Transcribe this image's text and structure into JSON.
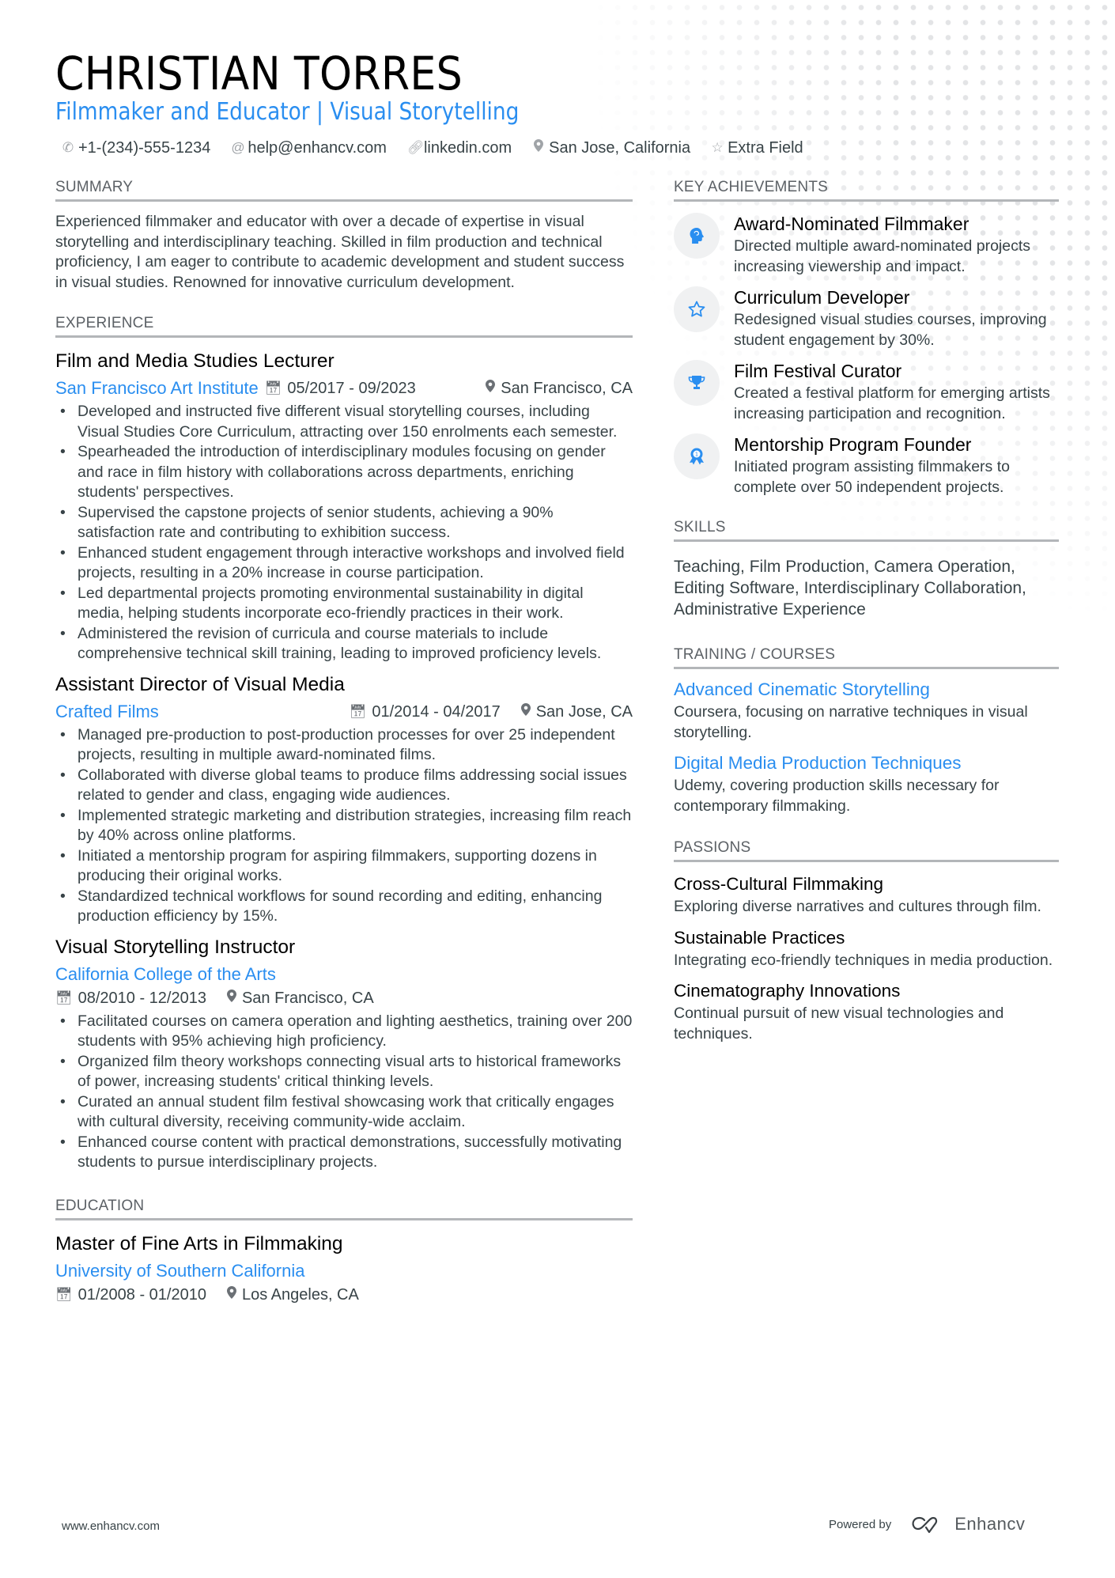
{
  "header": {
    "name": "CHRISTIAN TORRES",
    "headline": "Filmmaker and Educator | Visual Storytelling",
    "contacts": [
      {
        "icon": "phone-icon",
        "value": "+1-(234)-555-1234"
      },
      {
        "icon": "at-icon",
        "value": "help@enhancv.com"
      },
      {
        "icon": "link-icon",
        "value": "linkedin.com"
      },
      {
        "icon": "location-icon",
        "value": "San Jose, California"
      },
      {
        "icon": "star-icon",
        "value": "Extra Field"
      }
    ]
  },
  "summary": {
    "title": "SUMMARY",
    "text": "Experienced filmmaker and educator with over a decade of expertise in visual storytelling and interdisciplinary teaching. Skilled in film production and technical proficiency, I am eager to contribute to academic development and student success in visual studies. Renowned for innovative curriculum development."
  },
  "experience": {
    "title": "EXPERIENCE",
    "jobs": [
      {
        "title": "Film and Media Studies Lecturer",
        "company": "San Francisco Art Institute",
        "dates": "05/2017 - 09/2023",
        "location": "San Francisco, CA",
        "bullets": [
          "Developed and instructed five different visual storytelling courses, including Visual Studies Core Curriculum, attracting over 150 enrolments each semester.",
          "Spearheaded the introduction of interdisciplinary modules focusing on gender and race in film history with collaborations across departments, enriching students' perspectives.",
          "Supervised the capstone projects of senior students, achieving a 90% satisfaction rate and contributing to exhibition success.",
          "Enhanced student engagement through interactive workshops and involved field projects, resulting in a 20% increase in course participation.",
          "Led departmental projects promoting environmental sustainability in digital media, helping students incorporate eco-friendly practices in their work.",
          "Administered the revision of curricula and course materials to include comprehensive technical skill training, leading to improved proficiency levels."
        ]
      },
      {
        "title": "Assistant Director of Visual Media",
        "company": "Crafted Films",
        "dates": "01/2014 - 04/2017",
        "location": "San Jose, CA",
        "bullets": [
          "Managed pre-production to post-production processes for over 25 independent projects, resulting in multiple award-nominated films.",
          "Collaborated with diverse global teams to produce films addressing social issues related to gender and class, engaging wide audiences.",
          "Implemented strategic marketing and distribution strategies, increasing film reach by 40% across online platforms.",
          "Initiated a mentorship program for aspiring filmmakers, supporting dozens in producing their original works.",
          "Standardized technical workflows for sound recording and editing, enhancing production efficiency by 15%."
        ]
      },
      {
        "title": "Visual Storytelling Instructor",
        "company": "California College of the Arts",
        "dates": "08/2010 - 12/2013",
        "location": "San Francisco, CA",
        "bullets": [
          "Facilitated courses on camera operation and lighting aesthetics, training over 200 students with 95% achieving high proficiency.",
          "Organized film theory workshops connecting visual arts to historical frameworks of power, increasing students' critical thinking levels.",
          "Curated an annual student film festival showcasing work that critically engages with cultural diversity, receiving community-wide acclaim.",
          "Enhanced course content with practical demonstrations, successfully motivating students to pursue interdisciplinary projects."
        ]
      }
    ]
  },
  "education": {
    "title": "EDUCATION",
    "degree": "Master of Fine Arts in Filmmaking",
    "school": "University of Southern California",
    "dates": "01/2008 - 01/2010",
    "location": "Los Angeles, CA"
  },
  "achievements": {
    "title": "KEY ACHIEVEMENTS",
    "items": [
      {
        "icon": "brain-head-icon",
        "title": "Award-Nominated Filmmaker",
        "desc": "Directed multiple award-nominated projects increasing viewership and impact."
      },
      {
        "icon": "star-icon",
        "title": "Curriculum Developer",
        "desc": "Redesigned visual studies courses, improving student engagement by 30%."
      },
      {
        "icon": "trophy-icon",
        "title": "Film Festival Curator",
        "desc": "Created a festival platform for emerging artists increasing participation and recognition."
      },
      {
        "icon": "award-ribbon-icon",
        "title": "Mentorship Program Founder",
        "desc": "Initiated program assisting filmmakers to complete over 50 independent projects."
      }
    ]
  },
  "skills": {
    "title": "SKILLS",
    "text": "Teaching, Film Production, Camera Operation, Editing Software, Interdisciplinary Collaboration, Administrative Experience"
  },
  "training": {
    "title": "TRAINING / COURSES",
    "items": [
      {
        "title": "Advanced Cinematic Storytelling",
        "desc": "Coursera, focusing on narrative techniques in visual storytelling."
      },
      {
        "title": "Digital Media Production Techniques",
        "desc": "Udemy, covering production skills necessary for contemporary filmmaking."
      }
    ]
  },
  "passions": {
    "title": "PASSIONS",
    "items": [
      {
        "title": "Cross-Cultural Filmmaking",
        "desc": "Exploring diverse narratives and cultures through film."
      },
      {
        "title": "Sustainable Practices",
        "desc": "Integrating eco-friendly techniques in media production."
      },
      {
        "title": "Cinematography Innovations",
        "desc": "Continual pursuit of new visual technologies and techniques."
      }
    ]
  },
  "footer": {
    "website": "www.enhancv.com",
    "powered_by": "Powered by",
    "brand": "Enhancv"
  },
  "colors": {
    "accent": "#2a8ef0",
    "text": "#384347",
    "heading": "#000000",
    "rule": "#b3b6b9"
  }
}
